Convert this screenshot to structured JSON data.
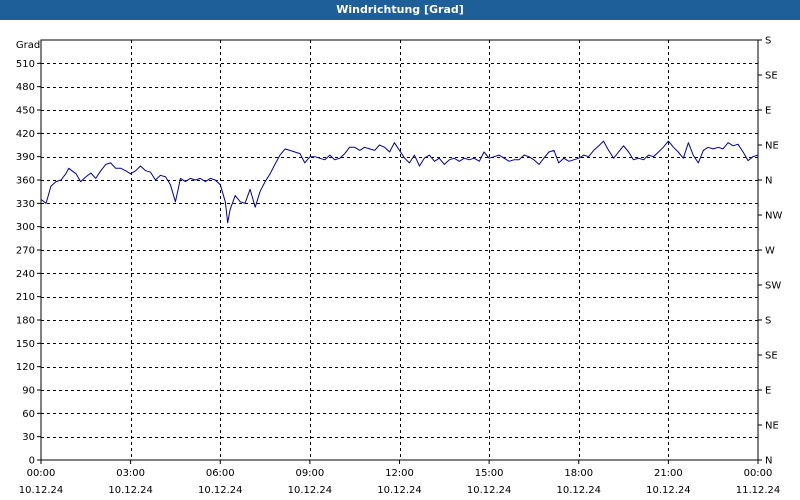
{
  "window": {
    "title": "Windrichtung [Grad]"
  },
  "chart_data": {
    "type": "line",
    "title": "Windrichtung [Grad]",
    "ylabel": "Grad",
    "xlabel": "",
    "ylim": [
      0,
      540
    ],
    "yticks": [
      0,
      30,
      60,
      90,
      120,
      150,
      180,
      210,
      240,
      270,
      300,
      330,
      360,
      390,
      420,
      450,
      480,
      510
    ],
    "right_axis_labels": [
      {
        "value": 0,
        "label": "N"
      },
      {
        "value": 45,
        "label": "NE"
      },
      {
        "value": 90,
        "label": "E"
      },
      {
        "value": 135,
        "label": "SE"
      },
      {
        "value": 180,
        "label": "S"
      },
      {
        "value": 225,
        "label": "SW"
      },
      {
        "value": 270,
        "label": "W"
      },
      {
        "value": 315,
        "label": "NW"
      },
      {
        "value": 360,
        "label": "N"
      },
      {
        "value": 405,
        "label": "NE"
      },
      {
        "value": 450,
        "label": "E"
      },
      {
        "value": 495,
        "label": "SE"
      },
      {
        "value": 540,
        "label": "S"
      }
    ],
    "x_range_hours": [
      0,
      24
    ],
    "xticks": [
      {
        "hour": 0,
        "time": "00:00",
        "date": "10.12.24"
      },
      {
        "hour": 3,
        "time": "03:00",
        "date": "10.12.24"
      },
      {
        "hour": 6,
        "time": "06:00",
        "date": "10.12.24"
      },
      {
        "hour": 9,
        "time": "09:00",
        "date": "10.12.24"
      },
      {
        "hour": 12,
        "time": "12:00",
        "date": "10.12.24"
      },
      {
        "hour": 15,
        "time": "15:00",
        "date": "10.12.24"
      },
      {
        "hour": 18,
        "time": "18:00",
        "date": "10.12.24"
      },
      {
        "hour": 21,
        "time": "21:00",
        "date": "10.12.24"
      },
      {
        "hour": 24,
        "time": "00:00",
        "date": "11.12.24"
      }
    ],
    "grid": true,
    "series": [
      {
        "color": "#0000aa",
        "points": [
          [
            0.0,
            335
          ],
          [
            0.17,
            330
          ],
          [
            0.33,
            352
          ],
          [
            0.5,
            358
          ],
          [
            0.67,
            360
          ],
          [
            0.83,
            368
          ],
          [
            0.93,
            375
          ],
          [
            1.17,
            368
          ],
          [
            1.33,
            358
          ],
          [
            1.5,
            364
          ],
          [
            1.67,
            369
          ],
          [
            1.83,
            362
          ],
          [
            2.0,
            372
          ],
          [
            2.17,
            380
          ],
          [
            2.33,
            382
          ],
          [
            2.5,
            375
          ],
          [
            2.67,
            375
          ],
          [
            2.83,
            372
          ],
          [
            3.0,
            368
          ],
          [
            3.17,
            372
          ],
          [
            3.33,
            378
          ],
          [
            3.5,
            372
          ],
          [
            3.67,
            370
          ],
          [
            3.83,
            360
          ],
          [
            4.0,
            366
          ],
          [
            4.17,
            364
          ],
          [
            4.33,
            354
          ],
          [
            4.5,
            332
          ],
          [
            4.67,
            362
          ],
          [
            4.83,
            358
          ],
          [
            5.0,
            362
          ],
          [
            5.17,
            360
          ],
          [
            5.33,
            362
          ],
          [
            5.5,
            358
          ],
          [
            5.67,
            362
          ],
          [
            5.83,
            360
          ],
          [
            6.0,
            354
          ],
          [
            6.17,
            332
          ],
          [
            6.25,
            305
          ],
          [
            6.33,
            322
          ],
          [
            6.5,
            340
          ],
          [
            6.67,
            332
          ],
          [
            6.83,
            330
          ],
          [
            7.0,
            348
          ],
          [
            7.17,
            325
          ],
          [
            7.33,
            345
          ],
          [
            7.5,
            358
          ],
          [
            7.67,
            368
          ],
          [
            7.83,
            380
          ],
          [
            8.0,
            392
          ],
          [
            8.17,
            400
          ],
          [
            8.33,
            398
          ],
          [
            8.5,
            396
          ],
          [
            8.67,
            394
          ],
          [
            8.83,
            382
          ],
          [
            9.0,
            390
          ],
          [
            9.17,
            390
          ],
          [
            9.33,
            388
          ],
          [
            9.5,
            386
          ],
          [
            9.67,
            392
          ],
          [
            9.83,
            386
          ],
          [
            10.0,
            388
          ],
          [
            10.17,
            394
          ],
          [
            10.33,
            402
          ],
          [
            10.5,
            402
          ],
          [
            10.67,
            398
          ],
          [
            10.83,
            402
          ],
          [
            11.0,
            400
          ],
          [
            11.17,
            398
          ],
          [
            11.33,
            405
          ],
          [
            11.5,
            402
          ],
          [
            11.67,
            396
          ],
          [
            11.83,
            408
          ],
          [
            12.0,
            398
          ],
          [
            12.17,
            388
          ],
          [
            12.33,
            382
          ],
          [
            12.5,
            392
          ],
          [
            12.67,
            378
          ],
          [
            12.83,
            388
          ],
          [
            13.0,
            392
          ],
          [
            13.17,
            384
          ],
          [
            13.33,
            388
          ],
          [
            13.5,
            380
          ],
          [
            13.67,
            386
          ],
          [
            13.83,
            388
          ],
          [
            14.0,
            384
          ],
          [
            14.17,
            388
          ],
          [
            14.33,
            386
          ],
          [
            14.5,
            388
          ],
          [
            14.67,
            384
          ],
          [
            14.83,
            396
          ],
          [
            15.0,
            388
          ],
          [
            15.17,
            390
          ],
          [
            15.33,
            392
          ],
          [
            15.5,
            388
          ],
          [
            15.67,
            384
          ],
          [
            15.83,
            386
          ],
          [
            16.0,
            386
          ],
          [
            16.17,
            392
          ],
          [
            16.33,
            390
          ],
          [
            16.5,
            386
          ],
          [
            16.67,
            380
          ],
          [
            16.83,
            388
          ],
          [
            17.0,
            396
          ],
          [
            17.17,
            398
          ],
          [
            17.33,
            382
          ],
          [
            17.5,
            388
          ],
          [
            17.67,
            384
          ],
          [
            17.83,
            386
          ],
          [
            18.0,
            388
          ],
          [
            18.17,
            392
          ],
          [
            18.33,
            390
          ],
          [
            18.5,
            398
          ],
          [
            18.67,
            404
          ],
          [
            18.83,
            410
          ],
          [
            19.0,
            398
          ],
          [
            19.17,
            388
          ],
          [
            19.33,
            396
          ],
          [
            19.5,
            404
          ],
          [
            19.67,
            396
          ],
          [
            19.83,
            386
          ],
          [
            20.0,
            388
          ],
          [
            20.17,
            386
          ],
          [
            20.33,
            392
          ],
          [
            20.5,
            390
          ],
          [
            20.67,
            396
          ],
          [
            20.83,
            402
          ],
          [
            21.0,
            410
          ],
          [
            21.17,
            402
          ],
          [
            21.33,
            396
          ],
          [
            21.5,
            388
          ],
          [
            21.67,
            408
          ],
          [
            21.83,
            392
          ],
          [
            22.0,
            382
          ],
          [
            22.17,
            398
          ],
          [
            22.33,
            402
          ],
          [
            22.5,
            400
          ],
          [
            22.67,
            402
          ],
          [
            22.83,
            400
          ],
          [
            23.0,
            408
          ],
          [
            23.17,
            404
          ],
          [
            23.33,
            406
          ],
          [
            23.5,
            396
          ],
          [
            23.67,
            385
          ],
          [
            23.83,
            390
          ],
          [
            24.0,
            392
          ]
        ]
      }
    ]
  }
}
